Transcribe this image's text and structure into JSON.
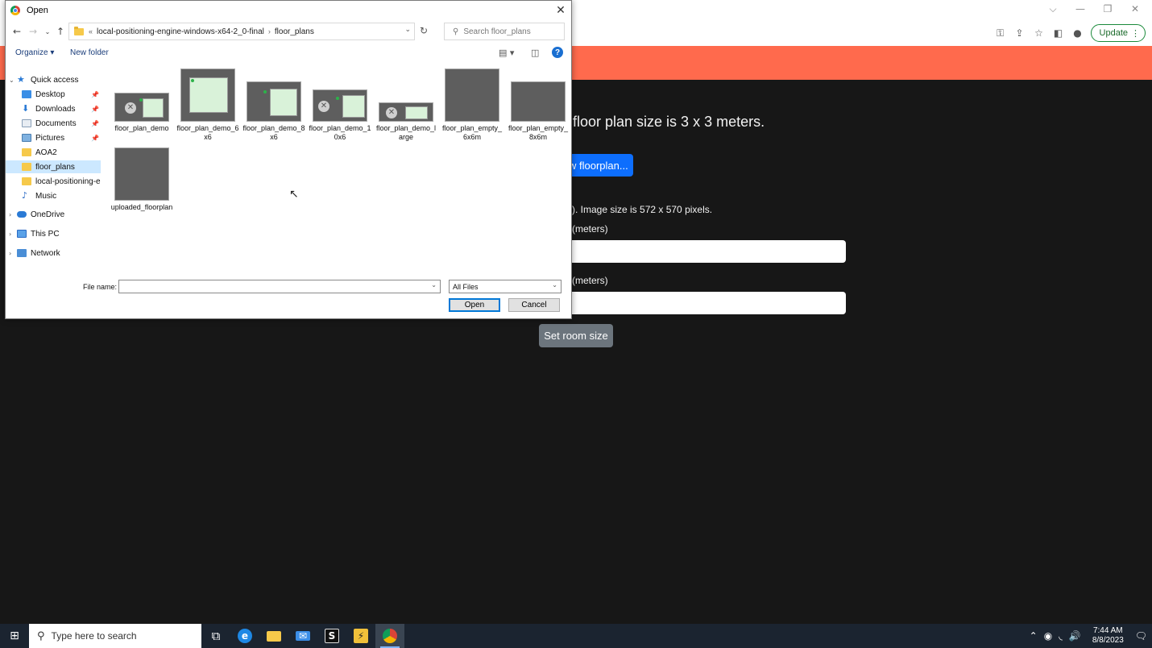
{
  "browser": {
    "window_controls": [
      "⌵",
      "—",
      "❐",
      "✕"
    ],
    "update_label": "Update"
  },
  "page": {
    "heading_fragment": "floor plan size is 3 x 3 meters.",
    "upload_button_fragment": "w floorplan...",
    "image_size_fragment": "rs). Image size is 572 x 570 pixels.",
    "width_label_fragment": "h (meters)",
    "height_label_fragment": "h (meters)",
    "set_room_size_label": "Set room size"
  },
  "dialog": {
    "title": "Open",
    "breadcrumb": [
      "local-positioning-engine-windows-x64-2_0-final",
      "floor_plans"
    ],
    "search_placeholder": "Search floor_plans",
    "organize_label": "Organize ▾",
    "new_folder_label": "New folder",
    "nav_items": [
      {
        "label": "Quick access",
        "icon": "star-icon"
      },
      {
        "label": "Desktop",
        "icon": "desktop-icon"
      },
      {
        "label": "Downloads",
        "icon": "download-icon"
      },
      {
        "label": "Documents",
        "icon": "documents-icon"
      },
      {
        "label": "Pictures",
        "icon": "pictures-icon"
      },
      {
        "label": "AOA2",
        "icon": "folder-icon"
      },
      {
        "label": "floor_plans",
        "icon": "folder-icon"
      },
      {
        "label": "local-positioning-e",
        "icon": "folder-icon"
      },
      {
        "label": "Music",
        "icon": "music-icon"
      },
      {
        "label": "OneDrive",
        "icon": "cloud-icon"
      },
      {
        "label": "This PC",
        "icon": "computer-icon"
      },
      {
        "label": "Network",
        "icon": "network-icon"
      }
    ],
    "files": [
      "floor_plan_demo",
      "floor_plan_demo_6x6",
      "floor_plan_demo_8x6",
      "floor_plan_demo_10x6",
      "floor_plan_demo_large",
      "floor_plan_empty_6x6m",
      "floor_plan_empty_8x6m",
      "uploaded_floorplan"
    ],
    "file_name_label": "File name:",
    "file_name_value": "",
    "file_type": "All Files",
    "open_label": "Open",
    "cancel_label": "Cancel"
  },
  "taskbar": {
    "search_placeholder": "Type here to search",
    "time": "7:44 AM",
    "date": "8/8/2023"
  },
  "colors": {
    "banner": "#ff6a4d",
    "primary_button": "#0d6efd",
    "secondary_button": "#6c757d",
    "page_background": "#171717"
  }
}
